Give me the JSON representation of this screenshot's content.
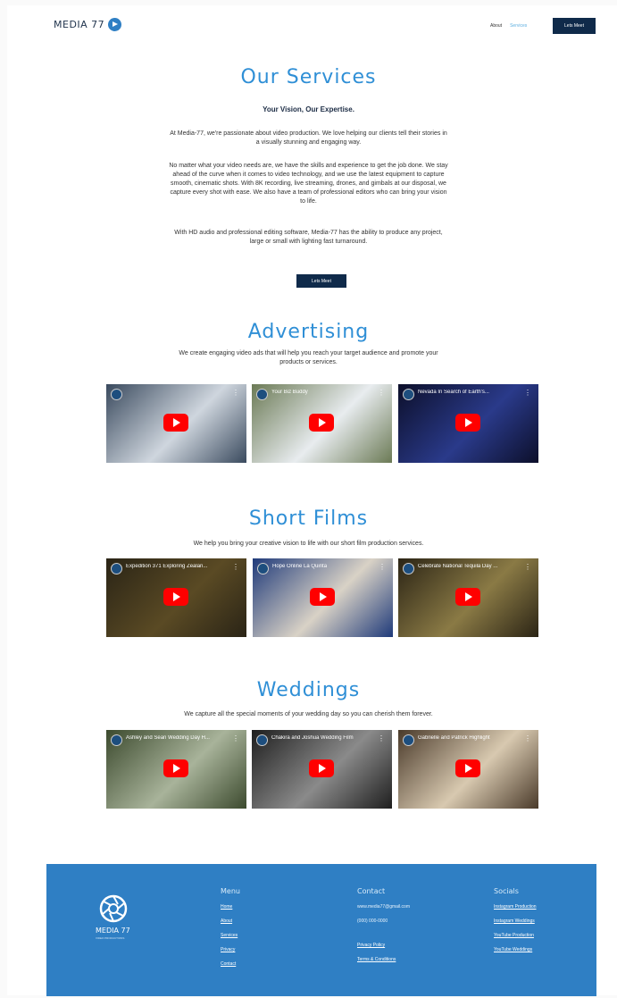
{
  "header": {
    "logo_text": "MEDIA 77",
    "nav": [
      {
        "label": "About",
        "active": false
      },
      {
        "label": "Services",
        "active": true
      }
    ],
    "cta": "Lets Meet"
  },
  "hero": {
    "title": "Our Services",
    "subtitle": "Your Vision, Our Expertise.",
    "p1": [
      "At Media-77, we're passionate about video production. We love helping our clients tell their stories in",
      "a visually stunning and engaging way."
    ],
    "p2": [
      "No matter what your video needs are, we have the skills and experience to get the job done. We stay",
      "ahead of the curve when it comes to video technology, and we use the latest equipment to capture",
      "smooth, cinematic shots. With 8K recording, live streaming, drones, and gimbals at our disposal, we",
      "capture every shot with ease. We also have a team of professional editors who can bring your vision",
      "to life."
    ],
    "p3": [
      "With HD audio and professional editing software, Media-77 has the ability to produce any project,",
      "large or small with lighting fast turnaround."
    ],
    "button": "Lets Meet"
  },
  "sections": [
    {
      "title": "Advertising",
      "desc": [
        "We create engaging video ads that will help you reach your target audience and promote your",
        "products or services."
      ],
      "videos": [
        {
          "title": "",
          "overlay": "",
          "bg": "#3a4a5e",
          "bg2": "#cfd6de"
        },
        {
          "title": "Your Biz Buddy",
          "overlay": "",
          "bg": "#6b7a55",
          "bg2": "#e8ecef"
        },
        {
          "title": "Nevada In Search of Earth's...",
          "overlay": "",
          "bg": "#0c0f2a",
          "bg2": "#2a3a8a"
        }
      ]
    },
    {
      "title": "Short Films",
      "desc": [
        "We help you bring your creative vision to life with our short film production services."
      ],
      "videos": [
        {
          "title": "Expedition 371 Exploring Zealan...",
          "overlay": "",
          "bg": "#2a2416",
          "bg2": "#5a4a24"
        },
        {
          "title": "Hope Online La Quinta",
          "overlay": "",
          "bg": "#1f3a7a",
          "bg2": "#d9d2c6"
        },
        {
          "title": "Celebrate National Tequila Day ...",
          "overlay": "",
          "bg": "#2b2415",
          "bg2": "#8a7a45"
        }
      ]
    },
    {
      "title": "Weddings",
      "desc": [
        "We capture all the special moments of your wedding day so you can cherish them forever."
      ],
      "videos": [
        {
          "title": "Ashley and Sean Wedding Day H...",
          "overlay": "",
          "bg": "#3c4a2e",
          "bg2": "#a8b39a"
        },
        {
          "title": "Chakira and Joshua Wedding Film",
          "overlay": "",
          "bg": "#1e1e1e",
          "bg2": "#8a8a8a"
        },
        {
          "title": "Gabrielle and Patrick Highlight",
          "overlay": "",
          "bg": "#4a3a2a",
          "bg2": "#d8c9b0"
        }
      ]
    }
  ],
  "footer": {
    "logo_text": "MEDIA 77",
    "logo_tag": "VIDEO PRODUCTIONS",
    "menu": {
      "heading": "Menu",
      "links": [
        "Home",
        "About",
        "Services",
        "Privacy",
        "Contact"
      ]
    },
    "contact": {
      "heading": "Contact",
      "lines": [
        "www.media77@gmail.com",
        "(000) 000-0000"
      ],
      "links": [
        "Privacy Policy",
        "Terms & Conditions"
      ]
    },
    "socials": {
      "heading": "Socials",
      "links": [
        "Instagram Production",
        "Instagram Weddings",
        "YouTube Production",
        "YouTube Weddings"
      ]
    }
  },
  "colors": {
    "brand_blue": "#2f8fd6",
    "navy": "#0f2a4a",
    "footer_blue": "#2f7fc4",
    "play_red": "#ff0000"
  }
}
